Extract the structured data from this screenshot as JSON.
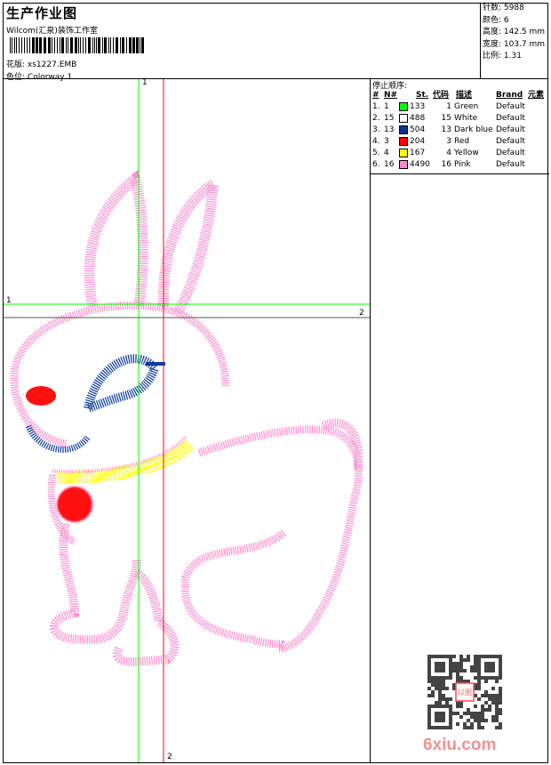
{
  "header": {
    "title": "生产作业图",
    "company": "Wilcom(汇泉)装饰工作室",
    "design_label": "花版:",
    "design_value": "xs1227.EMB",
    "colorway_label": "色位:",
    "colorway_value": "Colorway 1"
  },
  "stats": {
    "stitches": "针数: 5988",
    "colors": "颜色: 6",
    "height": "高度: 142.5 mm",
    "width": "宽度: 103.7 mm",
    "scale": "比例: 1.31"
  },
  "table": {
    "stop_sequence_label": "停止顺序:",
    "headers": [
      "#",
      "N#",
      "St.",
      "代码",
      "描述",
      "Brand",
      "元素"
    ],
    "rows": [
      {
        "idx": "1.",
        "n": "1",
        "color": "#00ff00",
        "st": "133",
        "code": "1",
        "desc": "Green",
        "brand": "Default"
      },
      {
        "idx": "2.",
        "n": "15",
        "color": "#ffffff",
        "st": "488",
        "code": "15",
        "desc": "White",
        "brand": "Default"
      },
      {
        "idx": "3.",
        "n": "13",
        "color": "#003399",
        "st": "504",
        "code": "13",
        "desc": "Dark blue",
        "brand": "Default"
      },
      {
        "idx": "4.",
        "n": "3",
        "color": "#ff0000",
        "st": "204",
        "code": "3",
        "desc": "Red",
        "brand": "Default"
      },
      {
        "idx": "5.",
        "n": "4",
        "color": "#ffff00",
        "st": "167",
        "code": "4",
        "desc": "Yellow",
        "brand": "Default"
      },
      {
        "idx": "6.",
        "n": "16",
        "color": "#ff88cc",
        "st": "4490",
        "code": "16",
        "desc": "Pink",
        "brand": "Default"
      }
    ]
  },
  "guides": {
    "v1": "1",
    "h1": "1",
    "h2": "2",
    "v2": "2"
  },
  "watermark": {
    "site": "6xiu.com",
    "seal": "以图制版"
  },
  "colors": {
    "pink": "#ff8fd0",
    "blue": "#0a3a9a",
    "red": "#ff1010",
    "yellow": "#ffff00",
    "green": "#00e000",
    "guide_green": "#00ff00",
    "guide_red": "#ff0000"
  }
}
